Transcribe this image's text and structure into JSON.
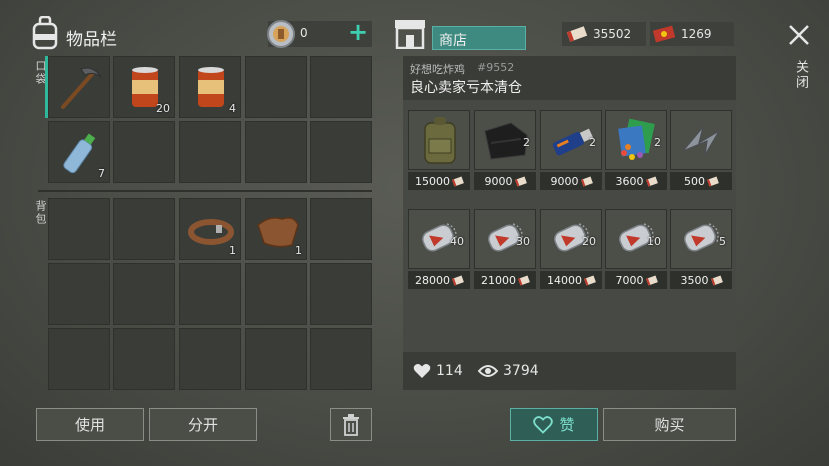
{
  "inventory": {
    "title": "物品栏",
    "pocket_label": "口袋",
    "backpack_label": "背包",
    "pocket_slots": [
      {
        "icon": "pickaxe-icon",
        "count": ""
      },
      {
        "icon": "canned-food-icon",
        "count": "20"
      },
      {
        "icon": "canned-food-icon",
        "count": "4"
      },
      {
        "icon": "",
        "count": ""
      },
      {
        "icon": "",
        "count": ""
      },
      {
        "icon": "water-bottle-icon",
        "count": "7"
      },
      {
        "icon": "",
        "count": ""
      },
      {
        "icon": "",
        "count": ""
      },
      {
        "icon": "",
        "count": ""
      },
      {
        "icon": "",
        "count": ""
      }
    ],
    "backpack_slots": [
      {
        "icon": "",
        "count": ""
      },
      {
        "icon": "",
        "count": ""
      },
      {
        "icon": "leather-strap-icon",
        "count": "1"
      },
      {
        "icon": "leather-scrap-icon",
        "count": "1"
      },
      {
        "icon": "",
        "count": ""
      }
    ]
  },
  "currency": {
    "coin_count": "0",
    "coupon_a": "35502",
    "coupon_b": "1269"
  },
  "buttons": {
    "use": "使用",
    "split": "分开",
    "like": "赞",
    "buy": "购买",
    "close": "关闭"
  },
  "shop": {
    "tab_label": "商店",
    "seller_name": "好想吃炸鸡",
    "seller_id": "#9552",
    "shop_name": "良心卖家亏本清仓",
    "likes": "114",
    "views": "3794",
    "items": [
      {
        "icon": "military-backpack-icon",
        "qty": "",
        "price": "15000"
      },
      {
        "icon": "black-cloth-icon",
        "qty": "2",
        "price": "9000"
      },
      {
        "icon": "usb-drive-icon",
        "qty": "2",
        "price": "9000"
      },
      {
        "icon": "colorful-parts-icon",
        "qty": "2",
        "price": "3600"
      },
      {
        "icon": "metal-scraps-icon",
        "qty": "",
        "price": "500"
      },
      {
        "icon": "dog-tag-icon",
        "qty": "40",
        "price": "28000"
      },
      {
        "icon": "dog-tag-icon",
        "qty": "30",
        "price": "21000"
      },
      {
        "icon": "dog-tag-icon",
        "qty": "20",
        "price": "14000"
      },
      {
        "icon": "dog-tag-icon",
        "qty": "10",
        "price": "7000"
      },
      {
        "icon": "dog-tag-icon",
        "qty": "5",
        "price": "3500"
      }
    ]
  }
}
